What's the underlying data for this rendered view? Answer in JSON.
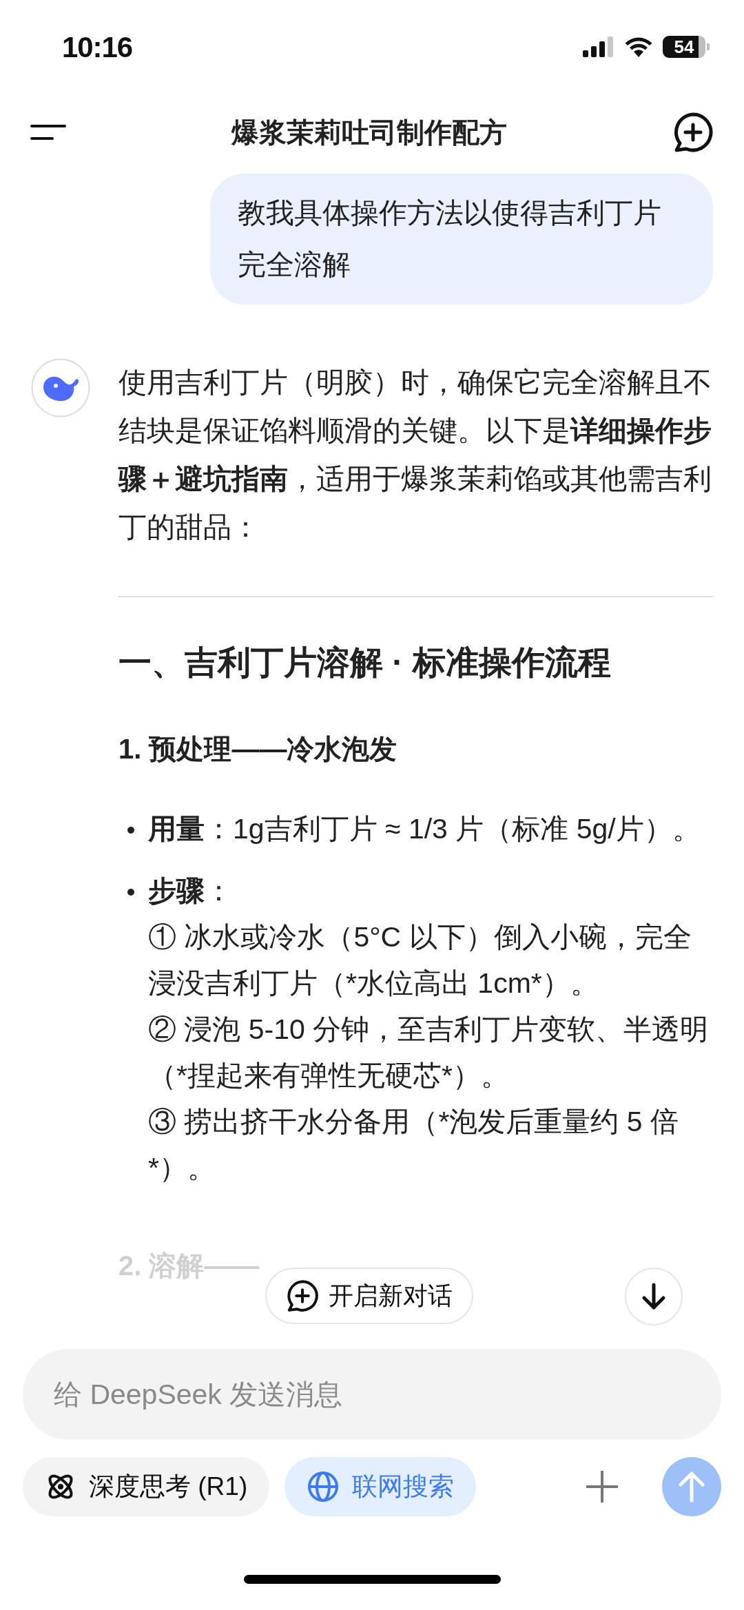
{
  "status_bar": {
    "time": "10:16",
    "battery": "54"
  },
  "header": {
    "title": "爆浆茉莉吐司制作配方"
  },
  "user_message": {
    "text": "教我具体操作方法以使得吉利丁片完全溶解"
  },
  "reply": {
    "intro": "使用吉利丁片（明胶）时，确保它完全溶解且不结块是保证馅料顺滑的关键。以下是**详细操作步骤＋避坑指南**，适用于爆浆茉莉馅或其他需吉利丁的甜品：",
    "heading": "一、吉利丁片溶解 · 标准操作流程",
    "subheading": "1. 预处理——冷水泡发",
    "bullets": [
      {
        "text": "**用量**：1g吉利丁片 ≈ 1/3 片（标准 5g/片）。"
      },
      {
        "text": "**步骤**：",
        "steps": [
          "① 冰水或冷水（5°C 以下）倒入小碗，完全浸没吉利丁片（*水位高出 1cm*）。",
          "② 浸泡 5-10 分钟，至吉利丁片变软、半透明（*捏起来有弹性无硬芯*）。",
          "③ 捞出挤干水分备用（*泡发后重量约 5 倍*）。"
        ]
      }
    ],
    "faded_subheading": "2. 溶解——"
  },
  "new_chat_button": {
    "label": "开启新对话"
  },
  "composer": {
    "placeholder": "给 DeepSeek 发送消息",
    "toggles": [
      {
        "kind": "deepthink",
        "label": "深度思考 (R1)",
        "selected": false
      },
      {
        "kind": "search",
        "label": "联网搜索",
        "selected": true
      }
    ],
    "send_enabled": false
  }
}
